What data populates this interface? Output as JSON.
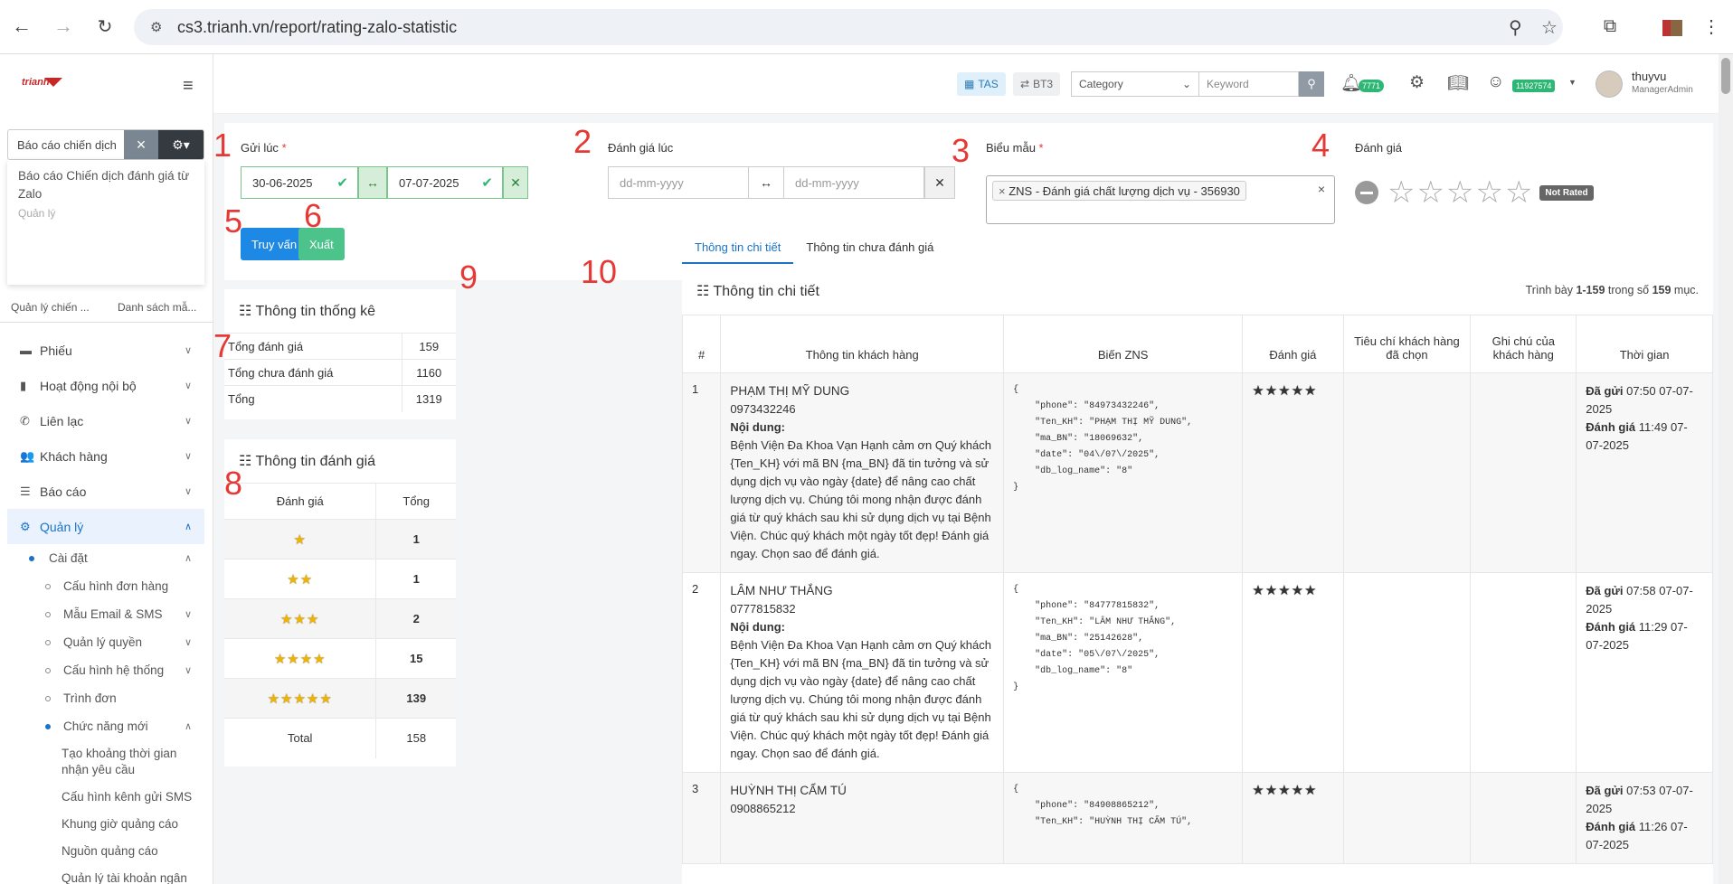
{
  "browser": {
    "url": "cs3.trianh.vn/report/rating-zalo-statistic"
  },
  "sidebar": {
    "logo": "trianh",
    "search_value": "Báo cáo chiến dịch",
    "dropdown_title": "Báo cáo Chiến dịch đánh giá từ Zalo",
    "dropdown_sub": "Quản lý",
    "tabs": [
      "Quản lý chiến ...",
      "Danh sách mẫ..."
    ],
    "menu": [
      {
        "label": "Phiếu",
        "icon": "ticket-icon"
      },
      {
        "label": "Hoạt động nội bộ",
        "icon": "bookmark-icon"
      },
      {
        "label": "Liên lạc",
        "icon": "phone-icon"
      },
      {
        "label": "Khách hàng",
        "icon": "users-icon"
      },
      {
        "label": "Báo cáo",
        "icon": "list-icon"
      },
      {
        "label": "Quản lý",
        "icon": "gears-icon"
      }
    ],
    "caidat": "Cài đặt",
    "caidat_items": [
      "Cấu hình đơn hàng",
      "Mẫu Email & SMS",
      "Quản lý quyền",
      "Cấu hình hệ thống",
      "Trình đơn"
    ],
    "chucnang": "Chức năng mới",
    "chucnang_items": [
      "Tạo khoảng thời gian nhận yêu cầu",
      "Cấu hình kênh gửi SMS",
      "Khung giờ quảng cáo",
      "Nguồn quảng cáo",
      "Quản lý tài khoản ngân hàng"
    ]
  },
  "topbar": {
    "tas": "TAS",
    "bt3": "BT3",
    "category": "Category",
    "keyword": "Keyword",
    "bell_count": "7771",
    "credit": "11927574",
    "user_name": "thuyvu",
    "user_role": "ManagerAdmin"
  },
  "filter": {
    "gui_luc": "Gửi lúc",
    "from_date": "30-06-2025",
    "to_date": "07-07-2025",
    "danh_gia_luc": "Đánh giá lúc",
    "date_placeholder": "dd-mm-yyyy",
    "bieu_mau": "Biểu mẫu",
    "template_tag": "ZNS - Đánh giá chất lượng dịch vụ - 356930",
    "danh_gia": "Đánh giá",
    "not_rated": "Not Rated",
    "query_btn": "Truy vấn",
    "export_btn": "Xuất"
  },
  "markers": [
    "1",
    "2",
    "3",
    "4",
    "5",
    "6",
    "7",
    "8",
    "9",
    "10"
  ],
  "stats": {
    "title": "Thông tin thống kê",
    "rows": [
      {
        "label": "Tổng đánh giá",
        "value": "159"
      },
      {
        "label": "Tổng chưa đánh giá",
        "value": "1160"
      },
      {
        "label": "Tổng",
        "value": "1319"
      }
    ]
  },
  "rating_info": {
    "title": "Thông tin đánh giá",
    "col1": "Đánh giá",
    "col2": "Tổng",
    "rows": [
      {
        "stars": "★",
        "value": "1"
      },
      {
        "stars": "★★",
        "value": "1"
      },
      {
        "stars": "★★★",
        "value": "2"
      },
      {
        "stars": "★★★★",
        "value": "15"
      },
      {
        "stars": "★★★★★",
        "value": "139"
      }
    ],
    "total_label": "Total",
    "total_value": "158"
  },
  "tabs": [
    "Thông tin chi tiết",
    "Thông tin chưa đánh giá"
  ],
  "detail": {
    "title": "Thông tin chi tiết",
    "showing_prefix": "Trình bày",
    "showing_range": "1-159",
    "showing_mid": "trong số",
    "showing_total": "159",
    "showing_suffix": "mục.",
    "headers": [
      "#",
      "Thông tin khách hàng",
      "Biến ZNS",
      "Đánh giá",
      "Tiêu chí khách hàng đã chọn",
      "Ghi chú của khách hàng",
      "Thời gian"
    ],
    "content_label": "Nội dung:",
    "message": "Bệnh Viện Đa Khoa Vạn Hạnh cảm ơn Quý khách {Ten_KH} với mã BN {ma_BN} đã tin tưởng và sử dụng dịch vụ vào ngày {date} để nâng cao chất lượng dịch vụ. Chúng tôi mong nhận được đánh giá từ quý khách sau khi sử dụng dịch vụ tại Bệnh Viện. Chúc quý khách một ngày tốt đẹp! Đánh giá ngay. Chọn sao để đánh giá.",
    "sent_label": "Đã gửi",
    "rated_label": "Đánh giá",
    "rows": [
      {
        "no": "1",
        "name": "PHẠM THỊ MỸ DUNG",
        "phone": "0973432246",
        "zns": "{\n    \"phone\": \"84973432246\",\n    \"Ten_KH\": \"PHẠM THỊ MỸ DUNG\",\n    \"ma_BN\": \"18069632\",\n    \"date\": \"04\\/07\\/2025\",\n    \"db_log_name\": \"8\"\n}",
        "stars": "★★★★★",
        "sent": "07:50 07-07-2025",
        "rated": "11:49 07-07-2025"
      },
      {
        "no": "2",
        "name": "LÂM NHƯ THẮNG",
        "phone": "0777815832",
        "zns": "{\n    \"phone\": \"84777815832\",\n    \"Ten_KH\": \"LÂM NHƯ THẮNG\",\n    \"ma_BN\": \"25142628\",\n    \"date\": \"05\\/07\\/2025\",\n    \"db_log_name\": \"8\"\n}",
        "stars": "★★★★★",
        "sent": "07:58 07-07-2025",
        "rated": "11:29 07-07-2025"
      },
      {
        "no": "3",
        "name": "HUỲNH THỊ CẨM TÚ",
        "phone": "0908865212",
        "zns": "{\n    \"phone\": \"84908865212\",\n    \"Ten_KH\": \"HUỲNH THỊ CẨM TÚ\",",
        "stars": "★★★★★",
        "sent": "07:53 07-07-2025",
        "rated": "11:26 07-07-2025"
      }
    ]
  }
}
